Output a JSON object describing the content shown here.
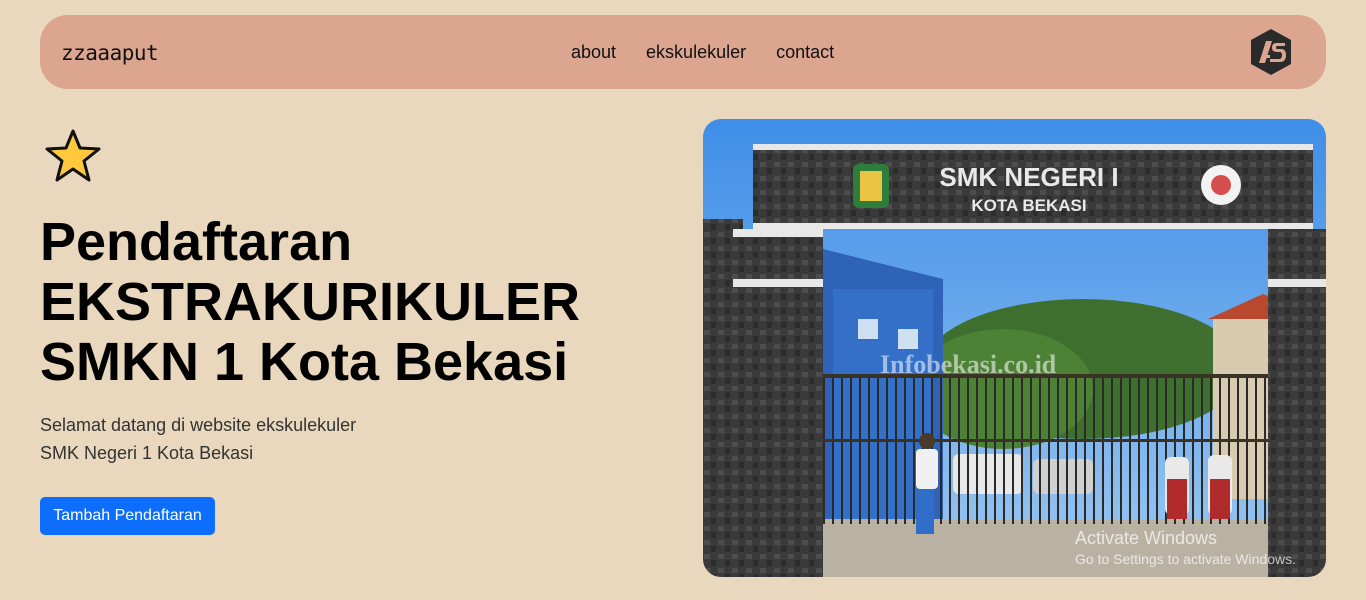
{
  "nav": {
    "brand": "zzaaaput",
    "links": [
      "about",
      "ekskulekuler",
      "contact"
    ],
    "logo_icon": "as-monogram-logo"
  },
  "hero": {
    "star_icon": "star-icon",
    "headline": [
      "Pendaftaran",
      "EKSTRAKURIKULER",
      "SMKN 1 Kota Bekasi"
    ],
    "subtext": [
      "Selamat datang di website ekskulekuler",
      "SMK Negeri 1 Kota Bekasi"
    ],
    "cta_label": "Tambah Pendaftaran"
  },
  "photo": {
    "gate_sign_line1": "SMK NEGERI I",
    "gate_sign_line2": "KOTA BEKASI",
    "watermark": "Infobekasi.co.id"
  },
  "overlay": {
    "activate_title": "Activate Windows",
    "activate_sub": "Go to Settings to activate Windows."
  },
  "colors": {
    "page_bg": "#e9d8bd",
    "navbar_bg": "#dba590",
    "button_bg": "#0d6efd"
  }
}
